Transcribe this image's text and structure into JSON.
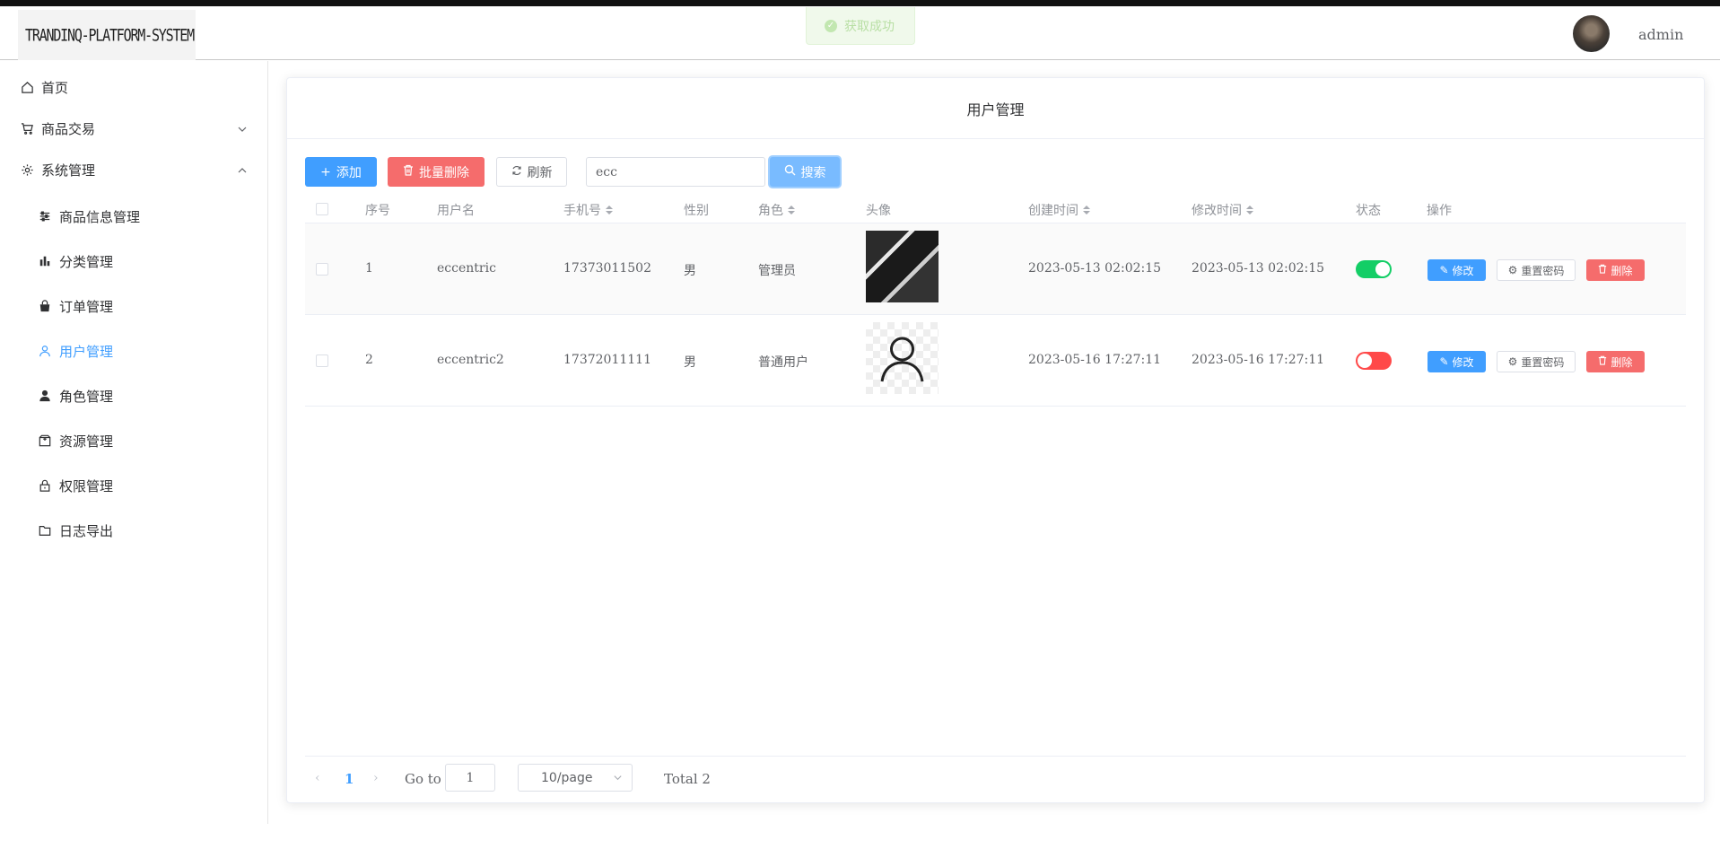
{
  "app": {
    "logo_text": "TRANDINQ-PLATFORM-SYSTEM",
    "toast_message": "获取成功",
    "user_name": "admin"
  },
  "sidebar": {
    "items": [
      {
        "label": "首页",
        "icon": "home-icon"
      },
      {
        "label": "商品交易",
        "icon": "cart-icon",
        "expanded": false
      },
      {
        "label": "系统管理",
        "icon": "gear-icon",
        "expanded": true
      },
      {
        "label": "商品信息管理",
        "icon": "sliders-icon"
      },
      {
        "label": "分类管理",
        "icon": "bar-chart-icon"
      },
      {
        "label": "订单管理",
        "icon": "shopping-bag-icon"
      },
      {
        "label": "用户管理",
        "icon": "user-icon",
        "active": true
      },
      {
        "label": "角色管理",
        "icon": "user-filled-icon"
      },
      {
        "label": "资源管理",
        "icon": "box-icon"
      },
      {
        "label": "权限管理",
        "icon": "lock-icon"
      },
      {
        "label": "日志导出",
        "icon": "folder-icon"
      }
    ]
  },
  "page": {
    "title": "用户管理"
  },
  "toolbar": {
    "add_label": "添加",
    "batch_delete_label": "批量删除",
    "refresh_label": "刷新",
    "search_value": "ecc",
    "search_label": "搜索"
  },
  "table": {
    "columns": [
      "序号",
      "用户名",
      "手机号",
      "性别",
      "角色",
      "头像",
      "创建时间",
      "修改时间",
      "状态",
      "操作"
    ],
    "rows": [
      {
        "index": "1",
        "username": "eccentric",
        "phone": "17373011502",
        "gender": "男",
        "role": "管理员",
        "created": "2023-05-13 02:02:15",
        "modified": "2023-05-13 02:02:15",
        "enabled": true
      },
      {
        "index": "2",
        "username": "eccentric2",
        "phone": "17372011111",
        "gender": "男",
        "role": "普通用户",
        "created": "2023-05-16 17:27:11",
        "modified": "2023-05-16 17:27:11",
        "enabled": false
      }
    ],
    "actions": {
      "edit": "修改",
      "reset_password": "重置密码",
      "delete": "删除"
    }
  },
  "pagination": {
    "current_page": "1",
    "goto_label": "Go to",
    "goto_value": "1",
    "page_size": "10/page",
    "total": "Total 2"
  },
  "colors": {
    "primary": "#409eff",
    "danger": "#f56c6c",
    "switch_on": "#13ce66",
    "switch_off": "#ff4949"
  }
}
